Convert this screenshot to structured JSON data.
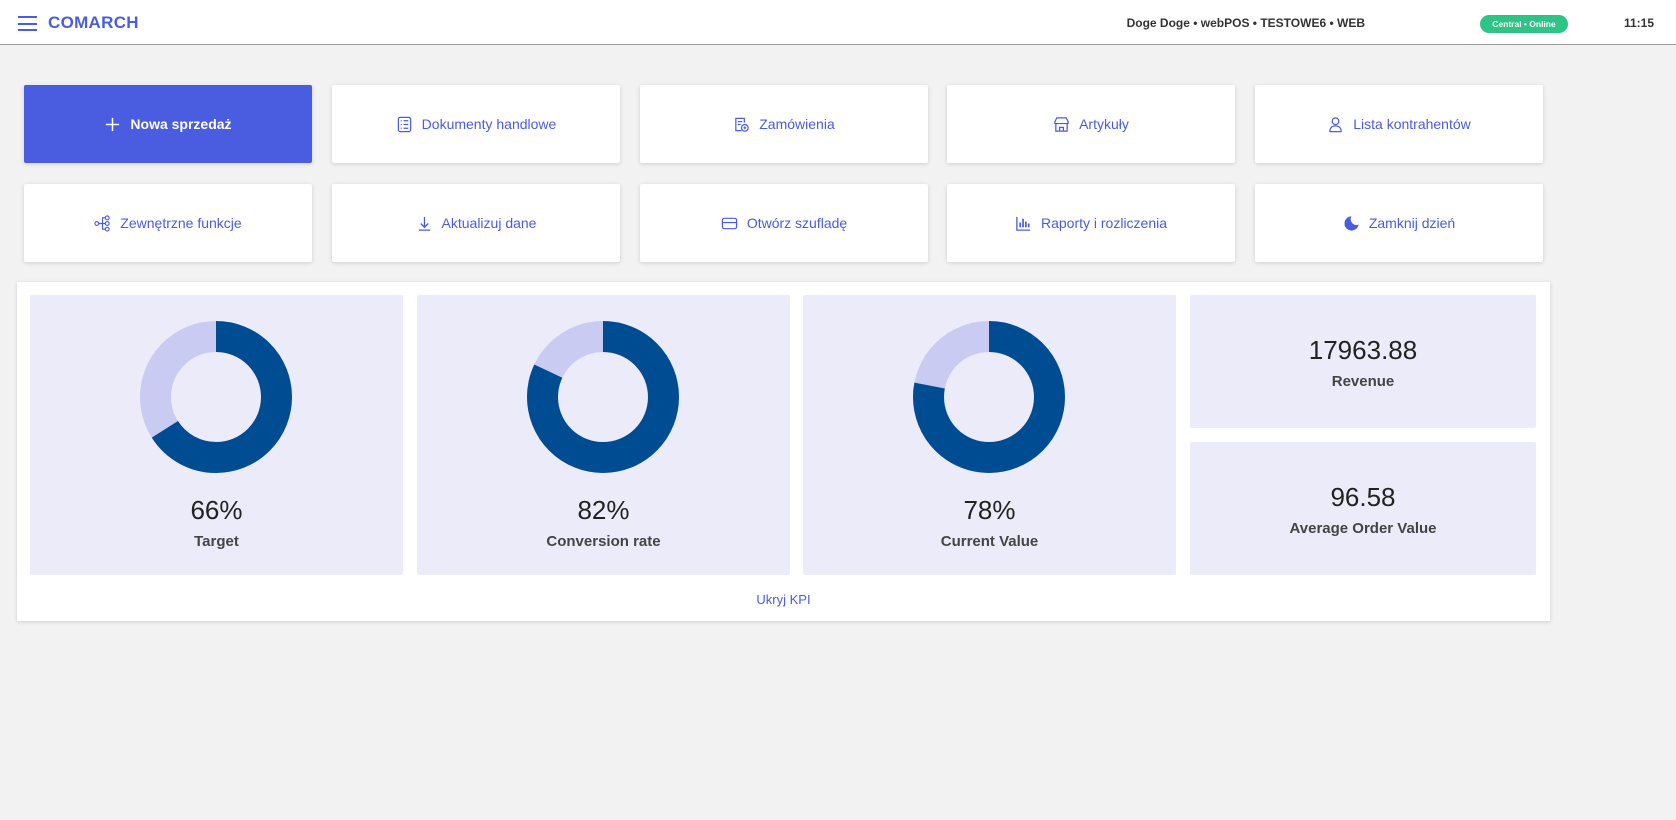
{
  "header": {
    "logo": "COMARCH",
    "user_info": "Doge Doge • webPOS • TESTOWE6 • WEB",
    "status": "Central • Online",
    "time": "11:15"
  },
  "actions": [
    {
      "label": "Nowa sprzedaż",
      "icon": "plus-icon"
    },
    {
      "label": "Dokumenty handlowe",
      "icon": "document-list-icon"
    },
    {
      "label": "Zamówienia",
      "icon": "order-icon"
    },
    {
      "label": "Artykuły",
      "icon": "store-icon"
    },
    {
      "label": "Lista kontrahentów",
      "icon": "user-icon"
    },
    {
      "label": "Zewnętrzne funkcje",
      "icon": "share-icon"
    },
    {
      "label": "Aktualizuj dane",
      "icon": "download-icon"
    },
    {
      "label": "Otwórz szufladę",
      "icon": "card-icon"
    },
    {
      "label": "Raporty i rozliczenia",
      "icon": "bar-chart-icon"
    },
    {
      "label": "Zamknij dzień",
      "icon": "moon-icon"
    }
  ],
  "kpi": {
    "donuts": [
      {
        "value": 66,
        "pct": "66%",
        "label": "Target"
      },
      {
        "value": 82,
        "pct": "82%",
        "label": "Conversion rate"
      },
      {
        "value": 78,
        "pct": "78%",
        "label": "Current Value"
      }
    ],
    "revenue": {
      "value": "17963.88",
      "label": "Revenue"
    },
    "aov": {
      "value": "96.58",
      "label": "Average Order Value"
    },
    "hide_label": "Ukryj KPI",
    "colors": {
      "filled": "#004c93",
      "empty": "#c9cbf2"
    }
  }
}
